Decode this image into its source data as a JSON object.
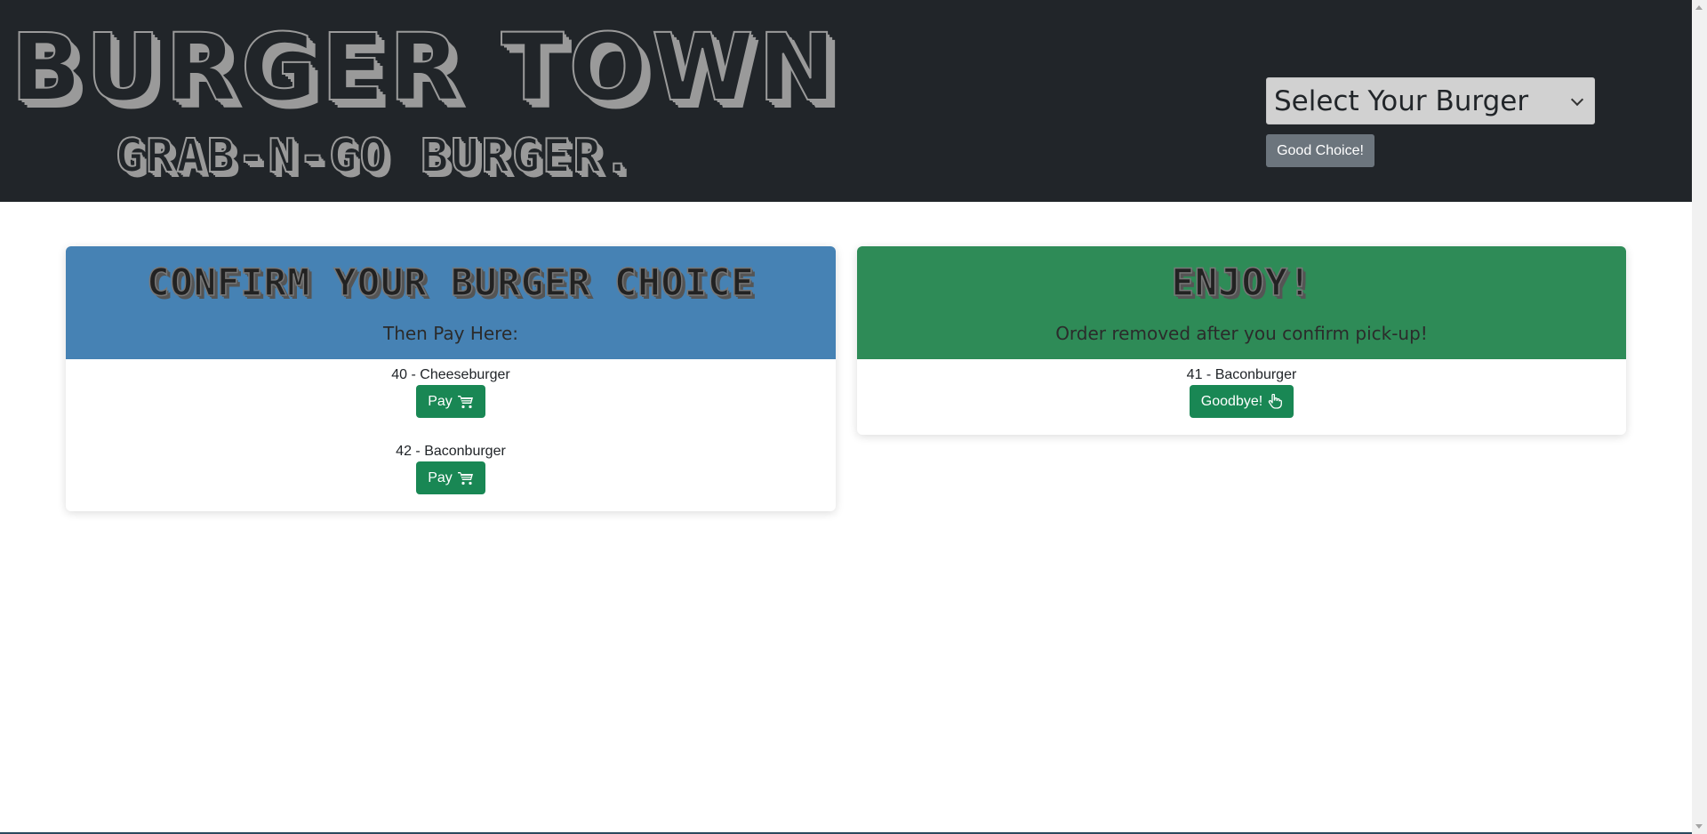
{
  "header": {
    "title": "BURGER TOWN",
    "subtitle": "GRAB-N-GO BURGER.",
    "select_value": "Select Your Burger",
    "submit_label": "Good Choice!"
  },
  "left_card": {
    "title": "CONFIRM YOUR BURGER CHOICE",
    "subtitle": "Then Pay Here:",
    "orders": [
      {
        "label": "40 - Cheeseburger",
        "button": "Pay"
      },
      {
        "label": "42 - Baconburger",
        "button": "Pay"
      }
    ]
  },
  "right_card": {
    "title": "ENJOY!",
    "subtitle": "Order removed after you confirm pick-up!",
    "orders": [
      {
        "label": "41 - Baconburger",
        "button": "Goodbye!"
      }
    ]
  },
  "colors": {
    "header_bg": "#212529",
    "left_card_header": "#4682b4",
    "right_card_header": "#2e8b57",
    "action_button": "#198754",
    "secondary_button": "#6c757d"
  },
  "icons": {
    "pay_button_icon": "cart-icon",
    "goodbye_button_icon": "hand-pointer-icon",
    "select_icon": "chevron-down-icon"
  }
}
